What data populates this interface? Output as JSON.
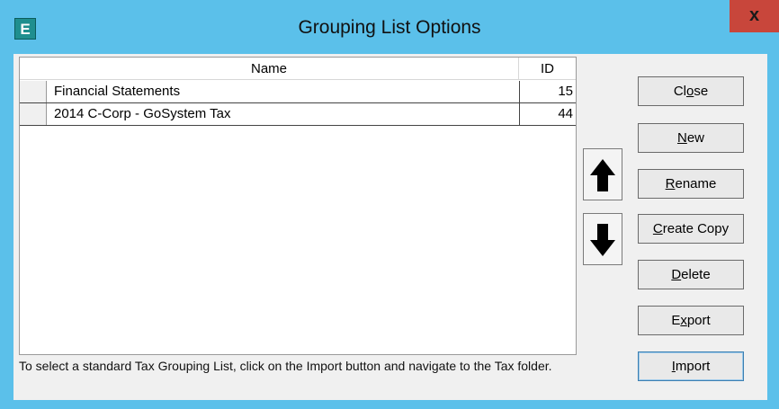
{
  "window": {
    "title": "Grouping List Options",
    "app_icon_letter": "E",
    "close_label": "x"
  },
  "table": {
    "columns": [
      "Name",
      "ID"
    ],
    "rows": [
      {
        "name": "Financial Statements",
        "id": "15"
      },
      {
        "name": "2014 C-Corp - GoSystem Tax",
        "id": "44"
      }
    ]
  },
  "info": "To select a standard Tax Grouping List, click on the Import button and navigate to the Tax folder.",
  "buttons": {
    "close": {
      "before": "Cl",
      "mnemonic": "o",
      "after": "se"
    },
    "new": {
      "before": "",
      "mnemonic": "N",
      "after": "ew"
    },
    "rename": {
      "before": "",
      "mnemonic": "R",
      "after": "ename"
    },
    "create_copy": {
      "before": "",
      "mnemonic": "C",
      "after": "reate Copy"
    },
    "delete": {
      "before": "",
      "mnemonic": "D",
      "after": "elete"
    },
    "export": {
      "before": "E",
      "mnemonic": "x",
      "after": "port"
    },
    "import": {
      "before": "",
      "mnemonic": "I",
      "after": "mport"
    }
  },
  "icons": {
    "move_up": "arrow-up-icon",
    "move_down": "arrow-down-icon"
  },
  "colors": {
    "titlebar": "#5bc0ea",
    "close_button": "#c8463b",
    "client_bg": "#f0f0f0"
  }
}
